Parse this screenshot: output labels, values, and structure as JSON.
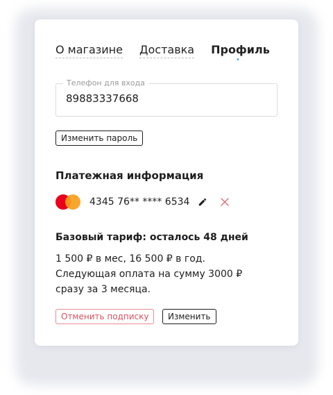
{
  "tabs": [
    {
      "label": "О магазине",
      "active": false
    },
    {
      "label": "Доставка",
      "active": false
    },
    {
      "label": "Профиль",
      "active": true
    }
  ],
  "phone": {
    "label": "Телефон для входа",
    "value": "89883337668"
  },
  "change_password_label": "Изменить пароль",
  "payment": {
    "title": "Платежная информация",
    "card_number": "4345 76** **** 6534",
    "card_icon": "mastercard-logo",
    "edit_icon": "pencil-icon",
    "delete_icon": "close-icon"
  },
  "plan": {
    "title": "Базовый тариф: осталось 48 дней",
    "lines": [
      "1 500 ₽ в мес, 16 500 ₽ в год.",
      "Следующая оплата на сумму 3000 ₽",
      "сразу за 3 месяца."
    ],
    "cancel_label": "Отменить подписку",
    "change_label": "Изменить"
  },
  "colors": {
    "cancel_accent": "#d8505f",
    "delete_icon": "#e06c78",
    "active_tab_marker": "#3da9f5"
  }
}
